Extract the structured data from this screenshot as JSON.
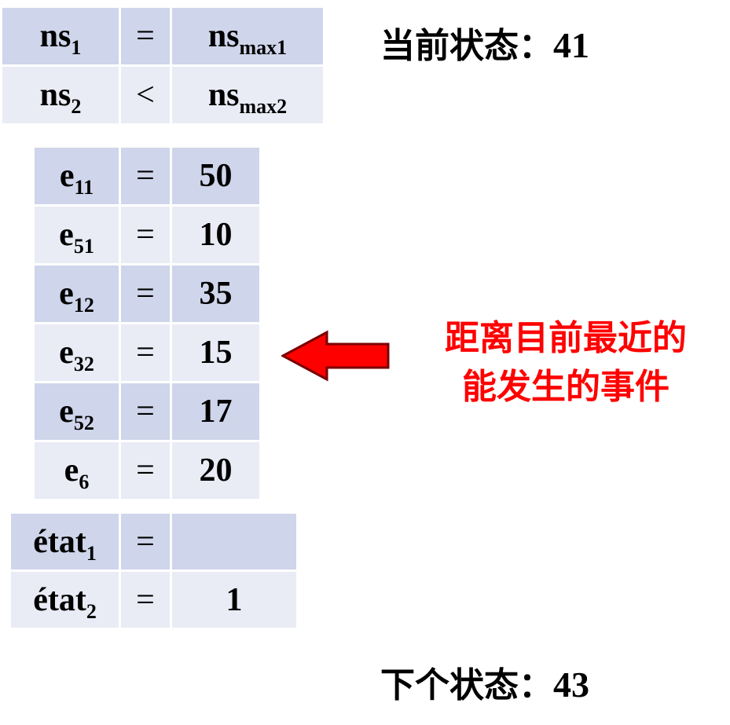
{
  "ns_table": {
    "rows": [
      {
        "base": "ns",
        "sub": "1",
        "op": "=",
        "rhs_base": "ns",
        "rhs_sub": "max1"
      },
      {
        "base": "ns",
        "sub": "2",
        "op": "<",
        "rhs_base": "ns",
        "rhs_sub": "max2"
      }
    ]
  },
  "event_table": {
    "rows": [
      {
        "base": "e",
        "sub": "11",
        "op": "=",
        "value": "50"
      },
      {
        "base": "e",
        "sub": "51",
        "op": "=",
        "value": "10"
      },
      {
        "base": "e",
        "sub": "12",
        "op": "=",
        "value": "35"
      },
      {
        "base": "e",
        "sub": "32",
        "op": "=",
        "value": "15"
      },
      {
        "base": "e",
        "sub": "52",
        "op": "=",
        "value": "17"
      },
      {
        "base": "e",
        "sub": "6",
        "op": "=",
        "value": "20"
      }
    ]
  },
  "etat_table": {
    "rows": [
      {
        "base": "état",
        "sub": "1",
        "op": "=",
        "value": ""
      },
      {
        "base": "état",
        "sub": "2",
        "op": "=",
        "value": "1"
      }
    ]
  },
  "current_state": {
    "label": "当前状态：",
    "value": "41"
  },
  "next_state": {
    "label": "下个状态：",
    "value": "43"
  },
  "annotation": {
    "line1": "距离目前最近的",
    "line2": "能发生的事件"
  },
  "colors": {
    "cell_dark": "#cfd5ea",
    "cell_light": "#e9ebf5",
    "arrow": "#ff0000",
    "annotation": "#ff0000"
  }
}
